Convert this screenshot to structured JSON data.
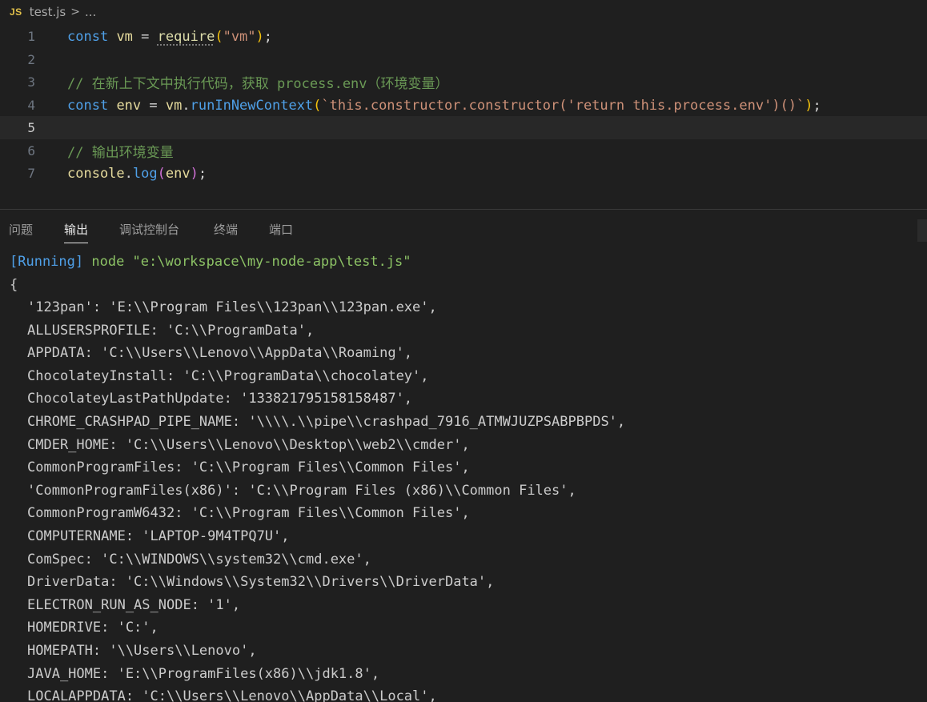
{
  "breadcrumb": {
    "icon": "JS",
    "file": "test.js",
    "separator": ">",
    "more": "..."
  },
  "editor": {
    "current_line": 5,
    "line_numbers": [
      "1",
      "2",
      "3",
      "4",
      "5",
      "6",
      "7"
    ],
    "line1": {
      "kw": "const",
      "name": "vm",
      "eq": "=",
      "fn": "require",
      "open": "(",
      "arg": "\"vm\"",
      "close": ")",
      "end": ";"
    },
    "line3": {
      "comment": "// 在新上下文中执行代码，获取 process.env（环境变量）"
    },
    "line4": {
      "kw": "const",
      "name": "env",
      "eq": "=",
      "obj": "vm",
      "dot": ".",
      "fn": "runInNewContext",
      "open": "(",
      "arg": "`this.constructor.constructor('return this.process.env')()`",
      "close": ")",
      "end": ";"
    },
    "line6": {
      "comment": "// 输出环境变量"
    },
    "line7": {
      "obj": "console",
      "dot": ".",
      "fn": "log",
      "open": "(",
      "arg": "env",
      "close": ")",
      "end": ";"
    }
  },
  "panel": {
    "tabs": [
      "问题",
      "输出",
      "调试控制台",
      "终端",
      "端口"
    ],
    "active_tab": "输出"
  },
  "output": {
    "running_tag": "[Running]",
    "running_cmd": " node \"e:\\workspace\\my-node-app\\test.js\"",
    "open_brace": "{",
    "lines": [
      "'123pan': 'E:\\\\Program Files\\\\123pan\\\\123pan.exe',",
      "ALLUSERSPROFILE: 'C:\\\\ProgramData',",
      "APPDATA: 'C:\\\\Users\\\\Lenovo\\\\AppData\\\\Roaming',",
      "ChocolateyInstall: 'C:\\\\ProgramData\\\\chocolatey',",
      "ChocolateyLastPathUpdate: '133821795158158487',",
      "CHROME_CRASHPAD_PIPE_NAME: '\\\\\\\\.\\\\pipe\\\\crashpad_7916_ATMWJUZPSABPBPDS',",
      "CMDER_HOME: 'C:\\\\Users\\\\Lenovo\\\\Desktop\\\\web2\\\\cmder',",
      "CommonProgramFiles: 'C:\\\\Program Files\\\\Common Files',",
      "'CommonProgramFiles(x86)': 'C:\\\\Program Files (x86)\\\\Common Files',",
      "CommonProgramW6432: 'C:\\\\Program Files\\\\Common Files',",
      "COMPUTERNAME: 'LAPTOP-9M4TPQ7U',",
      "ComSpec: 'C:\\\\WINDOWS\\\\system32\\\\cmd.exe',",
      "DriverData: 'C:\\\\Windows\\\\System32\\\\Drivers\\\\DriverData',",
      "ELECTRON_RUN_AS_NODE: '1',",
      "HOMEDRIVE: 'C:',",
      "HOMEPATH: '\\\\Users\\\\Lenovo',",
      "JAVA_HOME: 'E:\\\\ProgramFiles(x86)\\\\jdk1.8',",
      "LOCALAPPDATA: 'C:\\\\Users\\\\Lenovo\\\\AppData\\\\Local',"
    ]
  }
}
